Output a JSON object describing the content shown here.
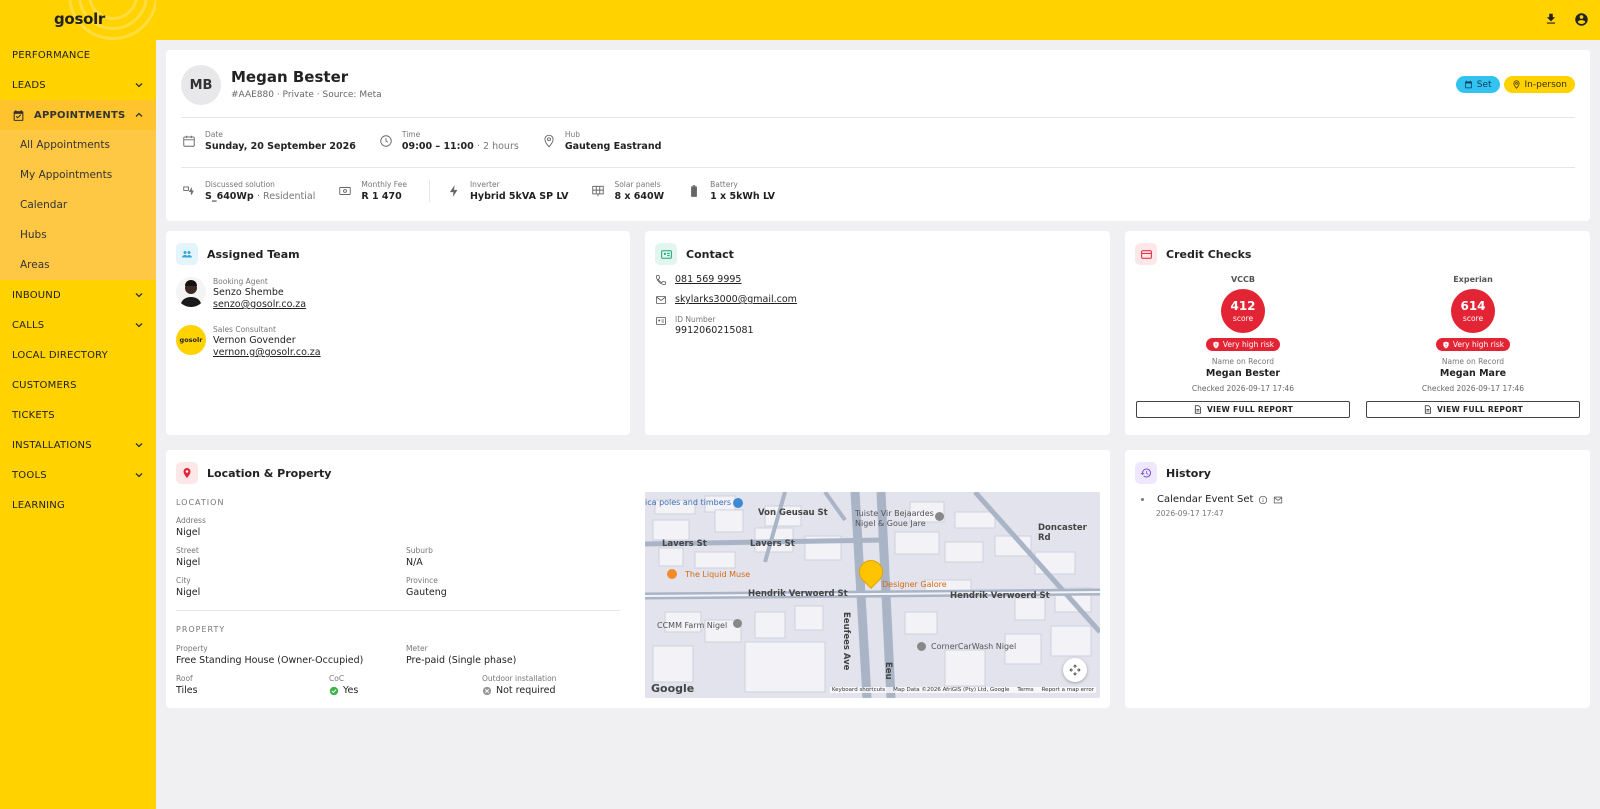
{
  "brand": {
    "logo": "gosolr",
    "accent": "#ffd200"
  },
  "topbar": {
    "icons": [
      "download-icon",
      "account-icon"
    ]
  },
  "sidebar": {
    "items": [
      {
        "label": "PERFORMANCE"
      },
      {
        "label": "LEADS",
        "expandable": true
      },
      {
        "label": "APPOINTMENTS",
        "expanded": true,
        "active": true
      },
      {
        "label": "INBOUND",
        "expandable": true
      },
      {
        "label": "CALLS",
        "expandable": true
      },
      {
        "label": "LOCAL DIRECTORY"
      },
      {
        "label": "CUSTOMERS"
      },
      {
        "label": "TICKETS"
      },
      {
        "label": "INSTALLATIONS",
        "expandable": true
      },
      {
        "label": "TOOLS",
        "expandable": true
      },
      {
        "label": "LEARNING"
      }
    ],
    "appointments_sub": [
      "All Appointments",
      "My Appointments",
      "Calendar",
      "Hubs",
      "Areas"
    ]
  },
  "header": {
    "initials": "MB",
    "name": "Megan Bester",
    "sub": "#AAE880 · Private · Source: Meta",
    "badges": {
      "set": "Set",
      "inperson": "In-person"
    },
    "date": {
      "label": "Date",
      "value": "Sunday, 20 September 2026"
    },
    "time": {
      "label": "Time",
      "value": "09:00 – 11:00",
      "extra": "· 2 hours"
    },
    "hub": {
      "label": "Hub",
      "value": "Gauteng Eastrand"
    },
    "solution": {
      "label": "Discussed solution",
      "value": "S_640Wp",
      "extra": "· Residential"
    },
    "fee": {
      "label": "Monthly Fee",
      "value": "R 1 470"
    },
    "inverter": {
      "label": "Inverter",
      "value": "Hybrid 5kVA SP LV"
    },
    "panels": {
      "label": "Solar panels",
      "value": "8 x 640W"
    },
    "battery": {
      "label": "Battery",
      "value": "1 x 5kWh LV"
    }
  },
  "team": {
    "title": "Assigned Team",
    "agent": {
      "role": "Booking Agent",
      "name": "Senzo Shembe",
      "email": "senzo@gosolr.co.za"
    },
    "consultant": {
      "role": "Sales Consultant",
      "name": "Vernon Govender",
      "email": "vernon.g@gosolr.co.za",
      "avatar_text": "gosolr"
    }
  },
  "contact": {
    "title": "Contact",
    "phone": "081 569 9995",
    "email": "skylarks3000@gmail.com",
    "id_label": "ID Number",
    "id_value": "9912060215081"
  },
  "credit": {
    "title": "Credit Checks",
    "bureaus": [
      {
        "name": "VCCB",
        "score": "412",
        "score_label": "score",
        "risk": "Very high risk",
        "nor_label": "Name on Record",
        "nor": "Megan Bester",
        "checked": "Checked 2026-09-17 17:46",
        "button": "VIEW FULL REPORT"
      },
      {
        "name": "Experian",
        "score": "614",
        "score_label": "score",
        "risk": "Very high risk",
        "nor_label": "Name on Record",
        "nor": "Megan Mare",
        "checked": "Checked 2026-09-17 17:46",
        "button": "VIEW FULL REPORT"
      }
    ]
  },
  "location": {
    "title": "Location & Property",
    "location_label": "LOCATION",
    "address": {
      "label": "Address",
      "value": "Nigel"
    },
    "street": {
      "label": "Street",
      "value": "Nigel"
    },
    "suburb": {
      "label": "Suburb",
      "value": "N/A"
    },
    "city": {
      "label": "City",
      "value": "Nigel"
    },
    "province": {
      "label": "Province",
      "value": "Gauteng"
    },
    "property_label": "PROPERTY",
    "property": {
      "label": "Property",
      "value": "Free Standing House (Owner-Occupied)"
    },
    "meter": {
      "label": "Meter",
      "value": "Pre-paid (Single phase)"
    },
    "roof": {
      "label": "Roof",
      "value": "Tiles"
    },
    "coc": {
      "label": "CoC",
      "value": "Yes"
    },
    "outdoor": {
      "label": "Outdoor installation",
      "value": "Not required"
    }
  },
  "map": {
    "labels": {
      "poles": "ica poles and timbers",
      "vongeusau": "Von Geusau St",
      "tuiste": "Tuiste Vir Bejaardes",
      "tuiste2": "Nigel & Goue Jare",
      "doncaster": "Doncaster Rd",
      "lavers1": "Lavers St",
      "lavers2": "Lavers St",
      "liquid": "The Liquid Muse",
      "designer": "Designer Galore",
      "hendrik1": "Hendrik Verwoerd St",
      "hendrik2": "Hendrik Verwoerd St",
      "ccmm": "CCMM Farm Nigel",
      "eeufees": "Eeufees Ave",
      "eeu2": "Eeu",
      "cornercar": "CornerCarWash Nigel",
      "google": "Google",
      "shortcuts": "Keyboard shortcuts",
      "mapdata": "Map Data ©2026 AfriGIS (Pty) Ltd, Google",
      "terms": "Terms",
      "report": "Report a map error"
    }
  },
  "history": {
    "title": "History",
    "items": [
      {
        "title": "Calendar Event Set",
        "time": "2026-09-17 17:47"
      }
    ]
  }
}
